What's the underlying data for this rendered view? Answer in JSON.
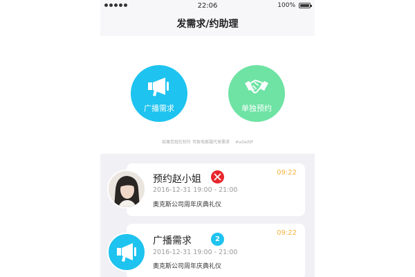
{
  "status_bar": {
    "time": "22:06",
    "battery": "100%"
  },
  "nav": {
    "title": "发需求/约助理"
  },
  "actions": {
    "broadcast": {
      "label": "广播需求",
      "icon": "megaphone-icon"
    },
    "solo": {
      "label": "单独预约",
      "icon": "handshake-icon"
    }
  },
  "hint": {
    "text": "如果您现在较忙 可致电客服代发需求",
    "code": "#adad9f"
  },
  "colors": {
    "broadcast": "#1ec3ef",
    "solo": "#6ee3a4",
    "time": "#f5b23b",
    "alert": "#e8262c"
  },
  "list": [
    {
      "title": "预约赵小姐",
      "badge_icon": "close-icon",
      "time": "09:22",
      "date": "2016-12-31 19:00 - 21:00",
      "event": "奥克斯公司周年庆典礼仪"
    },
    {
      "title": "广播需求",
      "badge": "2",
      "time": "09:22",
      "date": "2016-12-31 19:00 - 21:00",
      "event": "奥克斯公司周年庆典礼仪"
    }
  ]
}
